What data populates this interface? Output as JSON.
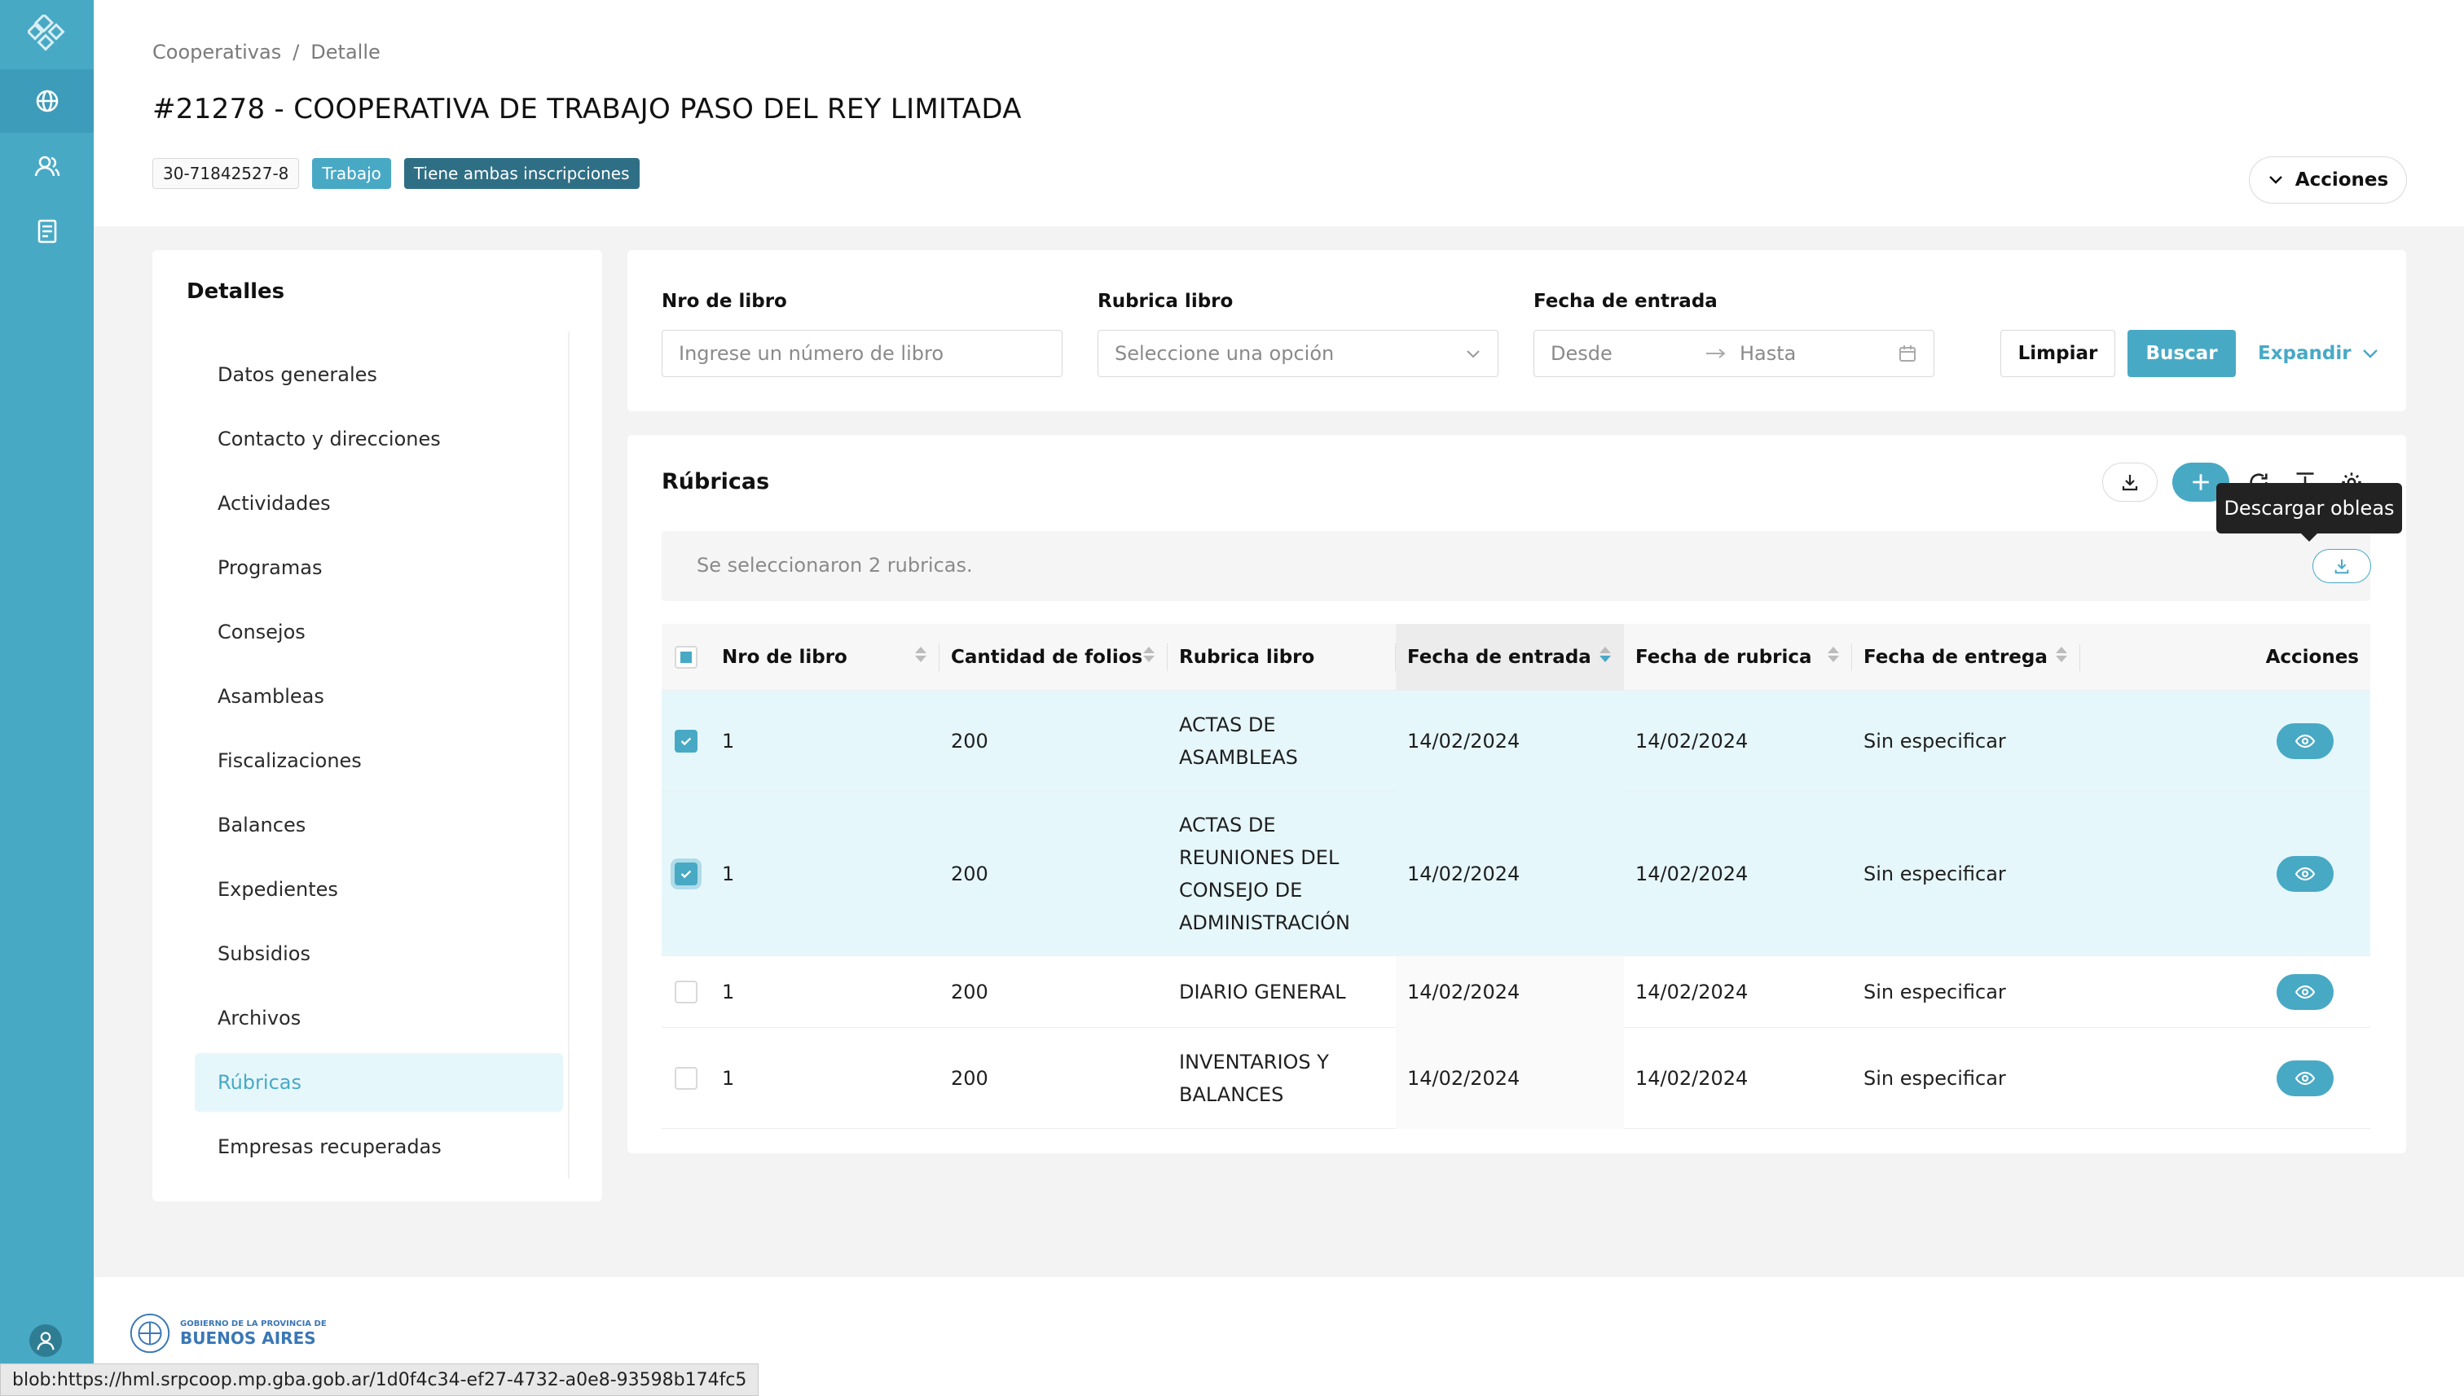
{
  "sidebar": {
    "items": [
      {
        "icon": "diamond-logo-icon"
      },
      {
        "icon": "globe-icon",
        "active": true
      },
      {
        "icon": "users-icon"
      },
      {
        "icon": "document-icon"
      }
    ],
    "user_icon": "user-icon"
  },
  "breadcrumb": {
    "items": [
      "Cooperativas",
      "/",
      "Detalle"
    ]
  },
  "page_title": "#21278 - COOPERATIVA DE TRABAJO PASO DEL REY LIMITADA",
  "tags": {
    "cuit": "30-71842527-8",
    "type": "Trabajo",
    "inscriptions": "Tiene ambas inscripciones"
  },
  "header_actions_label": "Acciones",
  "details": {
    "title": "Detalles",
    "items": [
      "Datos generales",
      "Contacto y direcciones",
      "Actividades",
      "Programas",
      "Consejos",
      "Asambleas",
      "Fiscalizaciones",
      "Balances",
      "Expedientes",
      "Subsidios",
      "Archivos",
      "Rúbricas",
      "Empresas recuperadas"
    ],
    "active_index": 11
  },
  "filters": {
    "libro_label": "Nro de libro",
    "libro_placeholder": "Ingrese un número de libro",
    "rubrica_label": "Rubrica libro",
    "rubrica_placeholder": "Seleccione una opción",
    "fecha_label": "Fecha de entrada",
    "desde_placeholder": "Desde",
    "hasta_placeholder": "Hasta",
    "limpiar_label": "Limpiar",
    "buscar_label": "Buscar",
    "expandir_label": "Expandir"
  },
  "table": {
    "title": "Rúbricas",
    "tooltip": "Descargar obleas",
    "selection_text": "Se seleccionaron 2 rubricas.",
    "columns": [
      "Nro de libro",
      "Cantidad de folios",
      "Rubrica libro",
      "Fecha de entrada",
      "Fecha de rubrica",
      "Fecha de entrega",
      "Acciones"
    ],
    "rows": [
      {
        "checked": true,
        "nro": "1",
        "folios": "200",
        "rubrica": [
          "ACTAS DE",
          "ASAMBLEAS"
        ],
        "entrada": "14/02/2024",
        "fecha_rubrica": "14/02/2024",
        "entrega": "Sin especificar"
      },
      {
        "checked": true,
        "nro": "1",
        "folios": "200",
        "rubrica": [
          "ACTAS DE",
          "REUNIONES DEL",
          "CONSEJO DE",
          "ADMINISTRACIÓN"
        ],
        "entrada": "14/02/2024",
        "fecha_rubrica": "14/02/2024",
        "entrega": "Sin especificar"
      },
      {
        "checked": false,
        "nro": "1",
        "folios": "200",
        "rubrica": [
          "DIARIO GENERAL"
        ],
        "entrada": "14/02/2024",
        "fecha_rubrica": "14/02/2024",
        "entrega": "Sin especificar"
      },
      {
        "checked": false,
        "nro": "1",
        "folios": "200",
        "rubrica": [
          "INVENTARIOS Y",
          "BALANCES"
        ],
        "entrada": "14/02/2024",
        "fecha_rubrica": "14/02/2024",
        "entrega": "Sin especificar"
      }
    ]
  },
  "footer": {
    "logo_line1": "GOBIERNO DE LA PROVINCIA DE",
    "logo_line2": "BUENOS AIRES"
  },
  "status_url": "blob:https://hml.srpcoop.mp.gba.gob.ar/1d0f4c34-ef27-4732-a0e8-93598b174fc5",
  "colors": {
    "accent": "#48a9c5",
    "sidebar": "#48a9c5",
    "dark_tag": "#2f6f86",
    "selected_row": "#e6f7fb"
  }
}
